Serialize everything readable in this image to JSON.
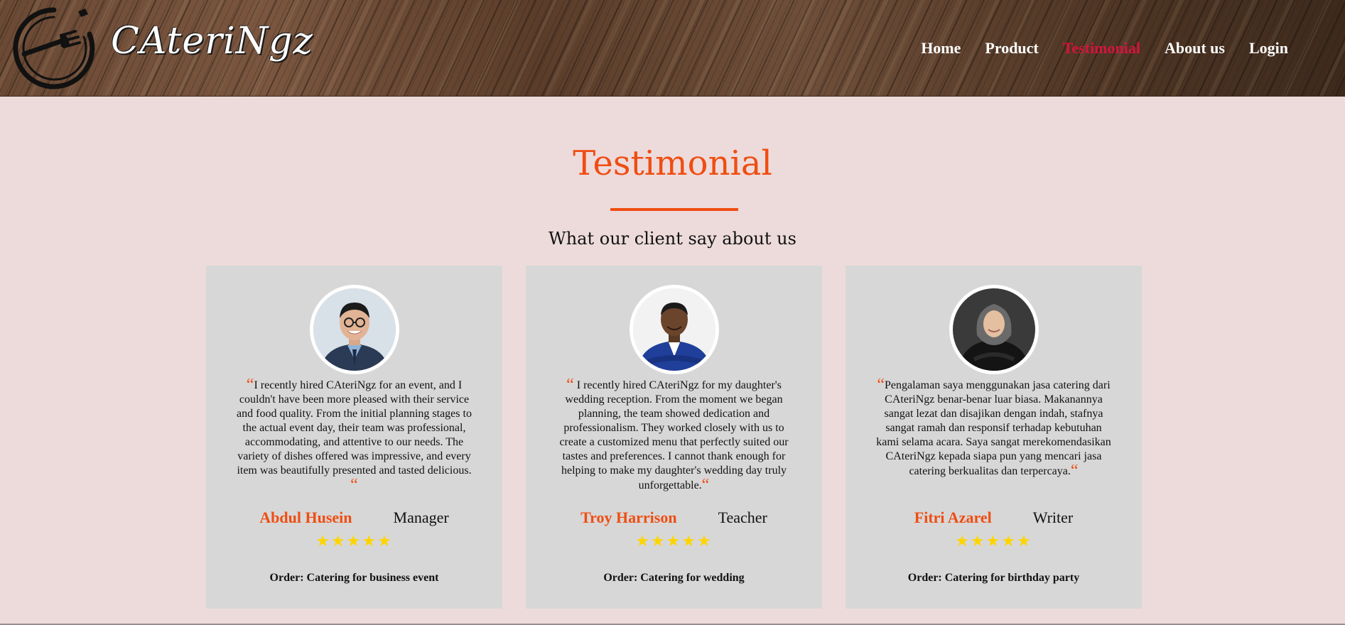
{
  "header": {
    "logo_text": "CAteriNgz",
    "nav": [
      {
        "label": "Home",
        "active": false
      },
      {
        "label": "Product",
        "active": false
      },
      {
        "label": "Testimonial",
        "active": true
      },
      {
        "label": "About us",
        "active": false
      },
      {
        "label": "Login",
        "active": false
      }
    ]
  },
  "section": {
    "title": "Testimonial",
    "subtitle": "What our client say about us"
  },
  "testimonials": [
    {
      "quote": "I recently hired CAteriNgz for an event, and I couldn't have been more pleased with their service and food quality. From the initial planning stages to the actual event day, their team was professional, accommodating, and attentive to our needs. The variety of dishes offered was impressive, and every item was beautifully presented and tasted delicious.",
      "name": "Abdul Husein",
      "role": "Manager",
      "stars": "★★★★★",
      "rating": 5,
      "order": "Order: Catering for business event"
    },
    {
      "quote": "I recently hired CAteriNgz for my daughter's wedding reception. From the moment we began planning, the team showed dedication and professionalism. They worked closely with us to create a customized menu that perfectly suited our tastes and preferences. I cannot thank enough for helping to make my daughter's wedding day truly unforgettable.",
      "name": "Troy Harrison",
      "role": "Teacher",
      "stars": "★★★★★",
      "rating": 5,
      "order": "Order: Catering for wedding"
    },
    {
      "quote": "Pengalaman saya menggunakan jasa catering dari CAteriNgz benar-benar luar biasa. Makanannya sangat lezat dan disajikan dengan indah, stafnya sangat ramah dan responsif terhadap kebutuhan kami selama acara. Saya sangat merekomendasikan CAteriNgz kepada siapa pun yang mencari jasa catering berkualitas dan terpercaya.",
      "name": "Fitri Azarel",
      "role": "Writer",
      "stars": "★★★★★",
      "rating": 5,
      "order": "Order: Catering for birthday party"
    }
  ],
  "colors": {
    "accent": "#f04d12",
    "nav_active": "#d4143c",
    "page_bg": "#eddbdb",
    "card_bg": "#d7d7d7",
    "star": "#ffd500"
  },
  "icons": {
    "logo": "plate-fork-icon",
    "quote": "quote-mark-icon",
    "star": "star-icon"
  }
}
